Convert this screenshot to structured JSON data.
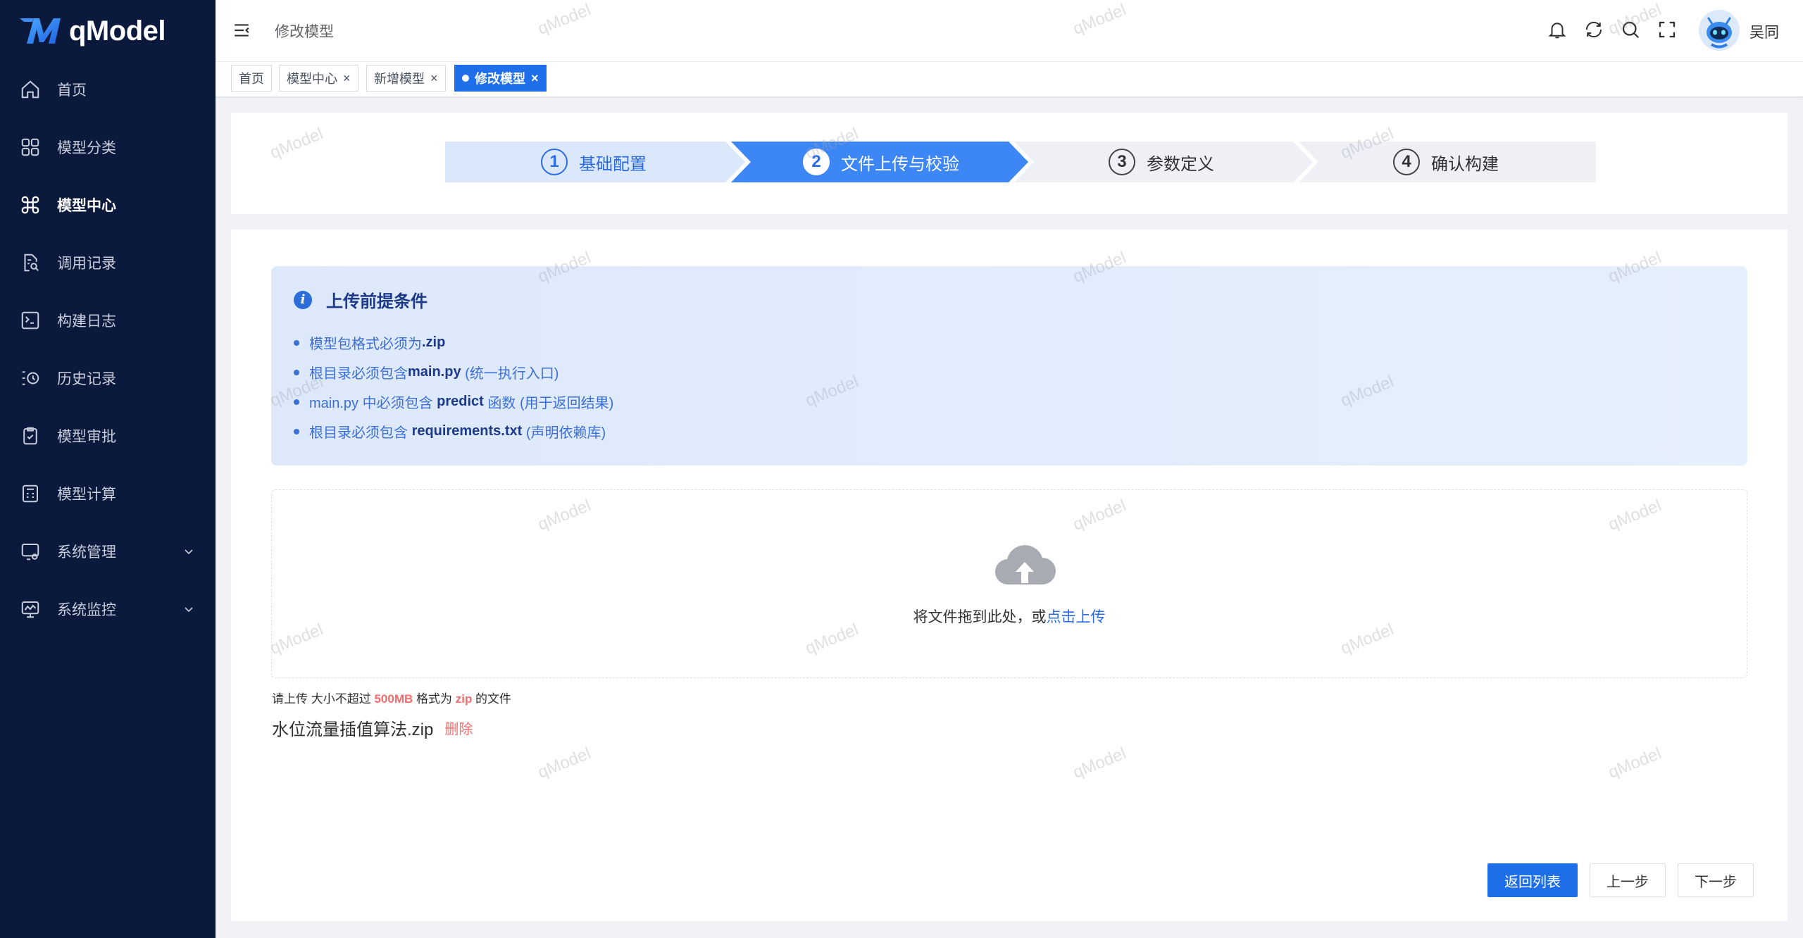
{
  "app": {
    "brand": "qModel"
  },
  "sidebar": {
    "items": [
      {
        "label": "首页",
        "icon": "home-icon"
      },
      {
        "label": "模型分类",
        "icon": "grid-icon"
      },
      {
        "label": "模型中心",
        "icon": "command-icon",
        "active": true
      },
      {
        "label": "调用记录",
        "icon": "document-search-icon"
      },
      {
        "label": "构建日志",
        "icon": "terminal-icon"
      },
      {
        "label": "历史记录",
        "icon": "history-list-icon"
      },
      {
        "label": "模型审批",
        "icon": "clipboard-check-icon"
      },
      {
        "label": "模型计算",
        "icon": "calculator-icon"
      },
      {
        "label": "系统管理",
        "icon": "settings-monitor-icon",
        "expandable": true
      },
      {
        "label": "系统监控",
        "icon": "monitor-chart-icon",
        "expandable": true
      }
    ]
  },
  "header": {
    "breadcrumb": "修改模型",
    "username": "吴同"
  },
  "tags": [
    {
      "label": "首页"
    },
    {
      "label": "模型中心"
    },
    {
      "label": "新增模型"
    },
    {
      "label": "修改模型",
      "active": true
    }
  ],
  "steps": [
    {
      "num": "1",
      "label": "基础配置",
      "state": "done"
    },
    {
      "num": "2",
      "label": "文件上传与校验",
      "state": "active"
    },
    {
      "num": "3",
      "label": "参数定义",
      "state": "pending"
    },
    {
      "num": "4",
      "label": "确认构建",
      "state": "pending"
    }
  ],
  "prereq": {
    "title": "上传前提条件",
    "rules": [
      {
        "pre": "模型包格式必须为 ",
        "bold": ".zip",
        "post": ""
      },
      {
        "pre": "根目录必须包含 ",
        "bold": "main.py",
        "post": " (统一执行入口)"
      },
      {
        "pre": "main.py 中必须包含 ",
        "bold": "predict",
        "post": " 函数 (用于返回结果)"
      },
      {
        "pre": "根目录必须包含 ",
        "bold": "requirements.txt",
        "post": " (声明依赖库)"
      }
    ]
  },
  "upload": {
    "drag_text": "将文件拖到此处，或",
    "click_text": "点击上传",
    "tip_prefix": "请上传 大小不超过 ",
    "tip_size": "500MB",
    "tip_mid": " 格式为 ",
    "tip_format": "zip",
    "tip_suffix": " 的文件",
    "file_name": "水位流量插值算法.zip",
    "delete_label": "删除"
  },
  "buttons": {
    "back_list": "返回列表",
    "prev": "上一步",
    "next": "下一步"
  },
  "watermark": "qModel",
  "colors": {
    "primary": "#1f6feb",
    "sidebar_bg": "#0b1a3c",
    "danger": "#f56c6c"
  }
}
